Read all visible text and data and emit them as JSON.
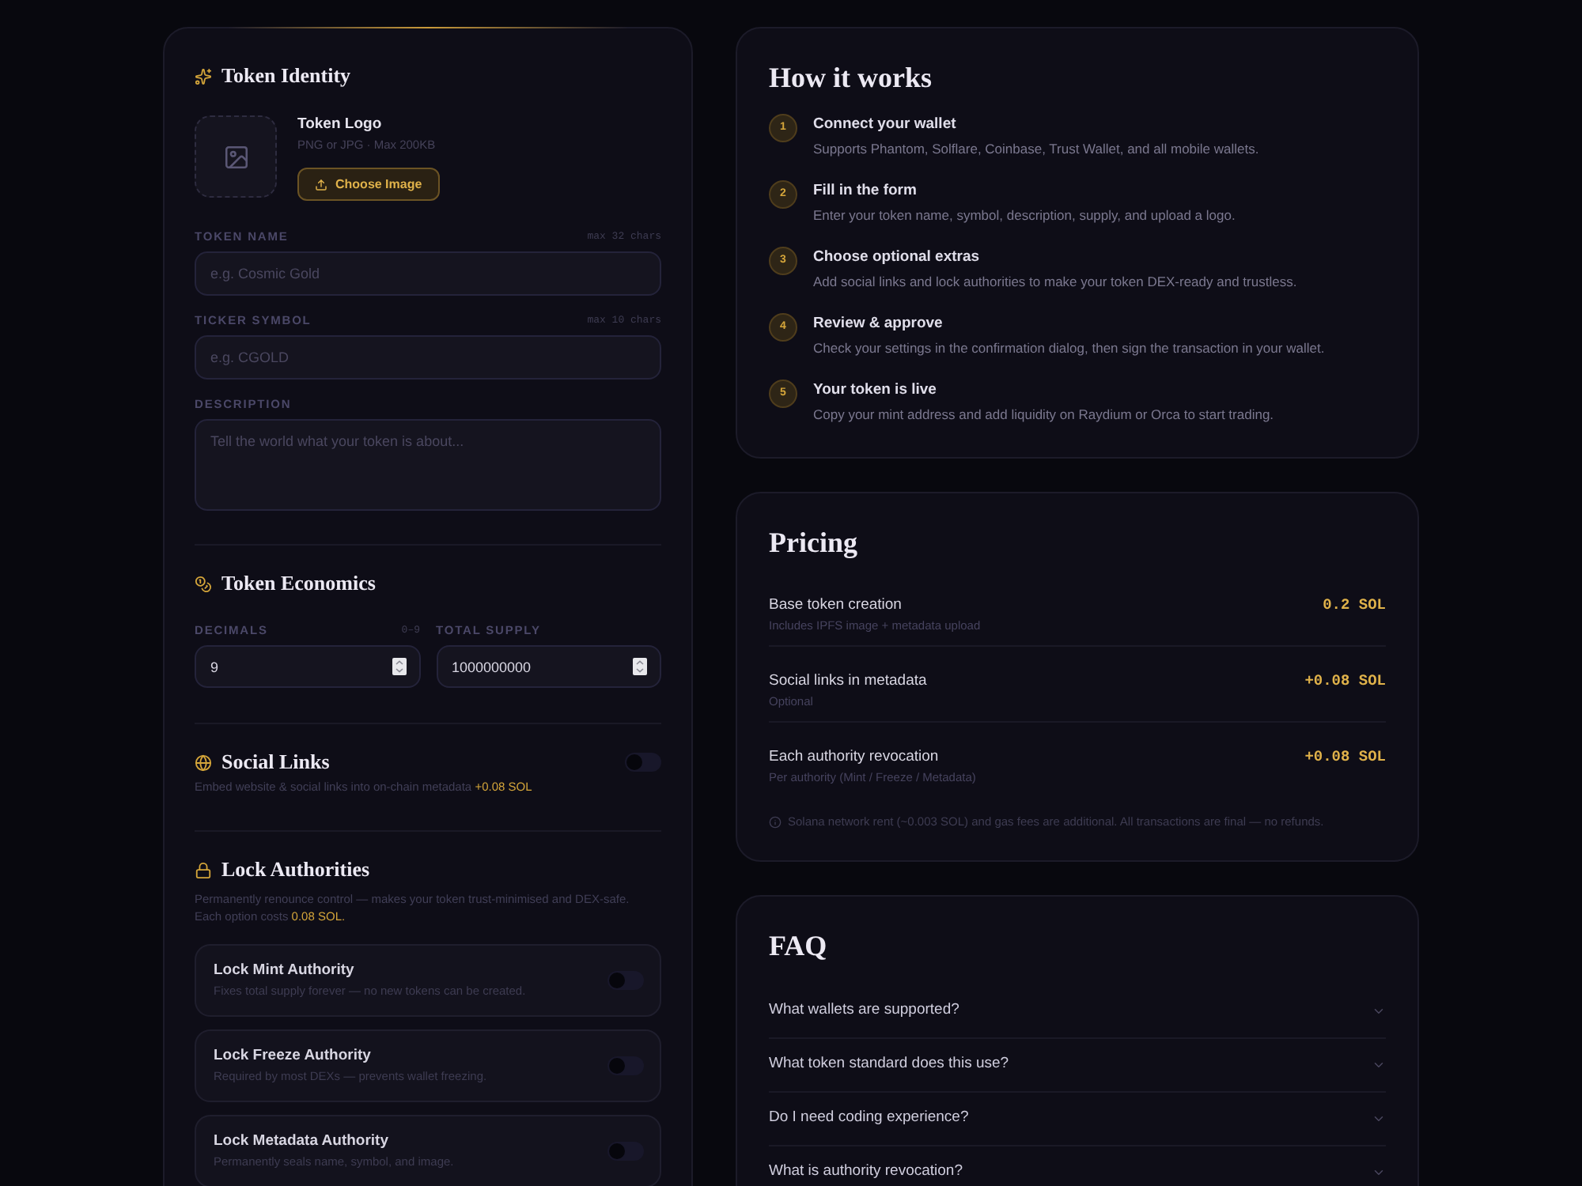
{
  "form": {
    "identity": {
      "title": "Token Identity",
      "logo": {
        "title": "Token Logo",
        "hint": "PNG or JPG · Max 200KB",
        "button": "Choose Image"
      },
      "fields": [
        {
          "kind": "input",
          "label": "TOKEN NAME",
          "limit": "max 32 chars",
          "placeholder": "e.g. Cosmic Gold"
        },
        {
          "kind": "input",
          "label": "TICKER SYMBOL",
          "limit": "max 10 chars",
          "placeholder": "e.g. CGOLD"
        },
        {
          "kind": "textarea",
          "label": "DESCRIPTION",
          "placeholder": "Tell the world what your token is about..."
        }
      ]
    },
    "economics": {
      "title": "Token Economics",
      "fields": [
        {
          "label": "DECIMALS",
          "hint": "0–9",
          "value": "9"
        },
        {
          "label": "TOTAL SUPPLY",
          "value": "1000000000"
        }
      ]
    },
    "social_links": {
      "title": "Social Links",
      "on": false,
      "description": "Embed website & social links into on-chain metadata",
      "price": "+0.08 SOL"
    },
    "lock_authorities": {
      "title": "Lock Authorities",
      "description": "Permanently renounce control — makes your token trust-minimised and DEX-safe. Each option costs",
      "price": "0.08 SOL.",
      "options": [
        {
          "title": "Lock Mint Authority",
          "description": "Fixes total supply forever — no new tokens can be created.",
          "on": false
        },
        {
          "title": "Lock Freeze Authority",
          "description": "Required by most DEXs — prevents wallet freezing.",
          "on": false
        },
        {
          "title": "Lock Metadata Authority",
          "description": "Permanently seals name, symbol, and image.",
          "on": false
        }
      ]
    }
  },
  "how_it_works": {
    "title": "How it works",
    "steps": [
      {
        "number": "1",
        "title": "Connect your wallet",
        "description": "Supports Phantom, Solflare, Coinbase, Trust Wallet, and all mobile wallets."
      },
      {
        "number": "2",
        "title": "Fill in the form",
        "description": "Enter your token name, symbol, description, supply, and upload a logo."
      },
      {
        "number": "3",
        "title": "Choose optional extras",
        "description": "Add social links and lock authorities to make your token DEX-ready and trustless."
      },
      {
        "number": "4",
        "title": "Review & approve",
        "description": "Check your settings in the confirmation dialog, then sign the transaction in your wallet."
      },
      {
        "number": "5",
        "title": "Your token is live",
        "description": "Copy your mint address and add liquidity on Raydium or Orca to start trading."
      }
    ]
  },
  "pricing": {
    "title": "Pricing",
    "rows": [
      {
        "label": "Base token creation",
        "note": "Includes IPFS image + metadata upload",
        "price": "0.2 SOL"
      },
      {
        "label": "Social links in metadata",
        "note": "Optional",
        "price": "+0.08 SOL"
      },
      {
        "label": "Each authority revocation",
        "note": "Per authority (Mint / Freeze / Metadata)",
        "price": "+0.08 SOL"
      }
    ],
    "footnote": "Solana network rent (~0.003 SOL) and gas fees are additional. All transactions are final — no refunds."
  },
  "faq": {
    "title": "FAQ",
    "items": [
      {
        "question": "What wallets are supported?",
        "expanded": false
      },
      {
        "question": "What token standard does this use?",
        "expanded": false
      },
      {
        "question": "Do I need coding experience?",
        "expanded": false
      },
      {
        "question": "What is authority revocation?",
        "expanded": false
      }
    ]
  }
}
